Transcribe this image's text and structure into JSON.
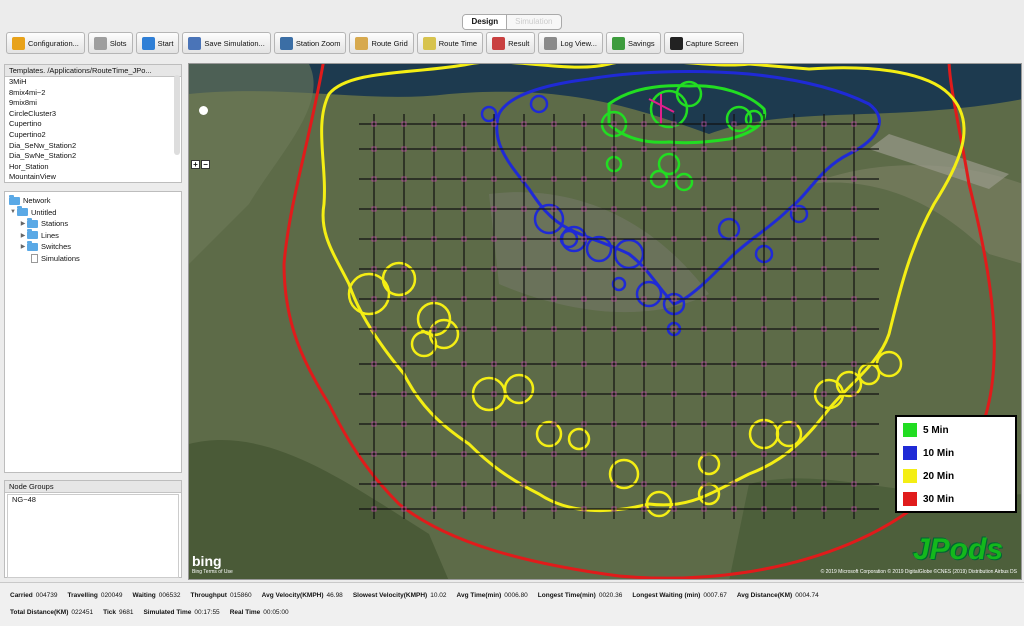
{
  "tabs": {
    "active": "Design",
    "inactive": "Simulation"
  },
  "toolbar": [
    {
      "id": "configuration",
      "label": "Configuration...",
      "icon": "gear-icon",
      "color": "#e8a21a"
    },
    {
      "id": "slots",
      "label": "Slots",
      "icon": "tools-icon",
      "color": "#9e9e9e"
    },
    {
      "id": "start",
      "label": "Start",
      "icon": "play-icon",
      "color": "#2f7fd6"
    },
    {
      "id": "save-simulation",
      "label": "Save Simulation...",
      "icon": "save-icon",
      "color": "#4a74b8"
    },
    {
      "id": "station-zoom",
      "label": "Station Zoom",
      "icon": "magnifier-icon",
      "color": "#3b6ea5"
    },
    {
      "id": "route-grid",
      "label": "Route Grid",
      "icon": "grid-icon",
      "color": "#d7a94e"
    },
    {
      "id": "route-time",
      "label": "Route Time",
      "icon": "route-icon",
      "color": "#d7c34e"
    },
    {
      "id": "result",
      "label": "Result",
      "icon": "chart-icon",
      "color": "#c94040"
    },
    {
      "id": "log-view",
      "label": "Log View...",
      "icon": "log-icon",
      "color": "#8a8a8a"
    },
    {
      "id": "savings",
      "label": "Savings",
      "icon": "money-icon",
      "color": "#3d9c3d"
    },
    {
      "id": "capture-screen",
      "label": "Capture Screen",
      "icon": "camera-icon",
      "color": "#222222"
    }
  ],
  "templates": {
    "header": "Templates. /Applications/RouteTime_JPo...",
    "items": [
      "3MiH",
      "8mix4mi~2",
      "9mix8mi",
      "CircleCluster3",
      "Cupertino",
      "Cupertino2",
      "Dia_SeNw_Station2",
      "Dia_SwNe_Station2",
      "Hor_Station",
      "MountainView"
    ]
  },
  "tree": {
    "root": "Network",
    "project": "Untitled",
    "children": [
      "Stations",
      "Lines",
      "Switches"
    ],
    "leaf": "Simulations"
  },
  "node_groups": {
    "header": "Node Groups",
    "items": [
      "NG~48"
    ]
  },
  "map": {
    "zoom_in": "+",
    "zoom_out": "−",
    "provider": "bing",
    "provider_sub": "Bing Terms of Use",
    "copyright": "© 2019 Microsoft Corporation © 2019 DigitalGlobe ©CNES (2019) Distribution Airbus DS",
    "brand": "JPods",
    "legend": [
      {
        "label": "5 Min",
        "color": "#22dd22"
      },
      {
        "label": "10 Min",
        "color": "#1f2ad6"
      },
      {
        "label": "20 Min",
        "color": "#f4ee14"
      },
      {
        "label": "30 Min",
        "color": "#e01b1b"
      }
    ]
  },
  "status": {
    "row1": [
      {
        "k": "Carried",
        "v": "004739"
      },
      {
        "k": "Travelling",
        "v": "020049"
      },
      {
        "k": "Waiting",
        "v": "006532"
      },
      {
        "k": "Throughput",
        "v": "015860"
      },
      {
        "k": "Avg Velocity(KMPH)",
        "v": "46.98"
      },
      {
        "k": "Slowest Velocity(KMPH)",
        "v": "10.02"
      },
      {
        "k": "Avg Time(min)",
        "v": "0006.80"
      },
      {
        "k": "Longest Time(min)",
        "v": "0020.36"
      },
      {
        "k": "Longest Waiting (min)",
        "v": "0007.67"
      },
      {
        "k": "Avg Distance(KM)",
        "v": "0004.74"
      }
    ],
    "row2": [
      {
        "k": "Total Distance(KM)",
        "v": "022451"
      },
      {
        "k": "Tick",
        "v": "9681"
      },
      {
        "k": "Simulated Time",
        "v": "00:17:55"
      },
      {
        "k": "Real Time",
        "v": "00:05:00"
      }
    ]
  }
}
